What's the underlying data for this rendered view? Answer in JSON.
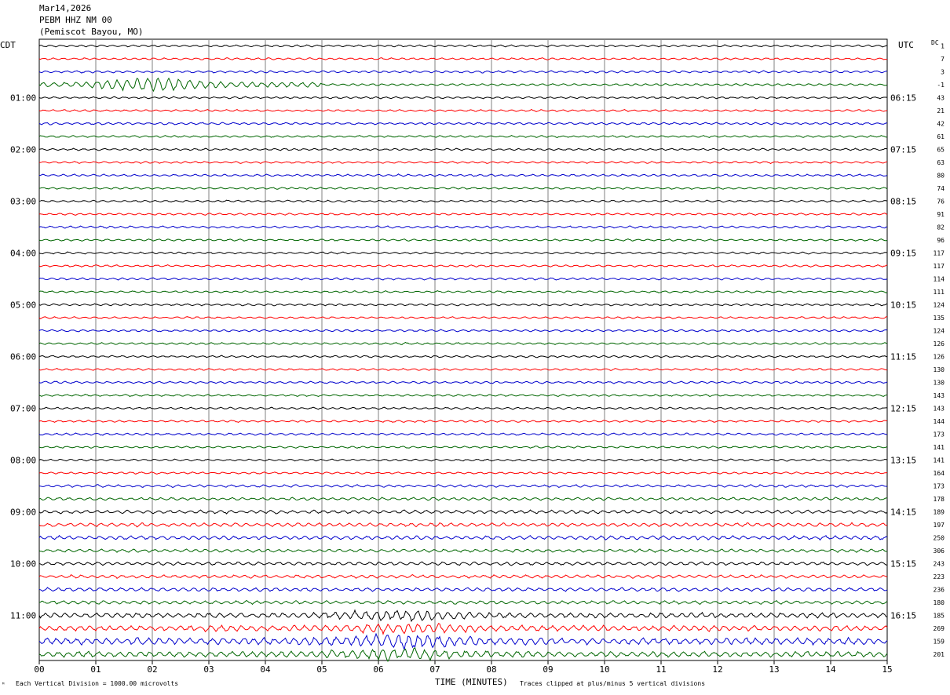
{
  "header": {
    "date": "Mar14,2026",
    "station": "PEBM HHZ NM 00",
    "location": "(Pemiscot Bayou, MO)"
  },
  "left_tz": "CDT",
  "right_tz": "UTC",
  "dc_label": "DC",
  "footer": {
    "scale_note": "Each Vertical Division = 1000.00 microvolts",
    "xlabel": "TIME (MINUTES)",
    "clip_note": "Traces clipped at plus/minus 5 vertical divisions"
  },
  "colors": {
    "trace_cycle": [
      "#000000",
      "#ff0000",
      "#0000cc",
      "#006600"
    ],
    "grid": "#808080"
  },
  "chart_data": {
    "type": "line",
    "title": "PEBM HHZ NM 00",
    "xlabel": "TIME (MINUTES)",
    "xlim": [
      0,
      15
    ],
    "x_ticks": [
      "00",
      "01",
      "02",
      "03",
      "04",
      "05",
      "06",
      "07",
      "08",
      "09",
      "10",
      "11",
      "12",
      "13",
      "14",
      "15"
    ],
    "left_hour_labels": [
      {
        "row": 4,
        "text": "01:00"
      },
      {
        "row": 8,
        "text": "02:00"
      },
      {
        "row": 12,
        "text": "03:00"
      },
      {
        "row": 16,
        "text": "04:00"
      },
      {
        "row": 20,
        "text": "05:00"
      },
      {
        "row": 24,
        "text": "06:00"
      },
      {
        "row": 28,
        "text": "07:00"
      },
      {
        "row": 32,
        "text": "08:00"
      },
      {
        "row": 36,
        "text": "09:00"
      },
      {
        "row": 40,
        "text": "10:00"
      },
      {
        "row": 44,
        "text": "11:00"
      }
    ],
    "right_hour_labels": [
      {
        "row": 4,
        "text": "06:15"
      },
      {
        "row": 8,
        "text": "07:15"
      },
      {
        "row": 12,
        "text": "08:15"
      },
      {
        "row": 16,
        "text": "09:15"
      },
      {
        "row": 20,
        "text": "10:15"
      },
      {
        "row": 24,
        "text": "11:15"
      },
      {
        "row": 28,
        "text": "12:15"
      },
      {
        "row": 32,
        "text": "13:15"
      },
      {
        "row": 36,
        "text": "14:15"
      },
      {
        "row": 40,
        "text": "15:15"
      },
      {
        "row": 44,
        "text": "16:15"
      }
    ],
    "dc_offsets": [
      "1",
      "7",
      "3",
      "-1",
      "43",
      "21",
      "42",
      "61",
      "65",
      "63",
      "80",
      "74",
      "76",
      "91",
      "82",
      "96",
      "117",
      "117",
      "114",
      "111",
      "124",
      "135",
      "124",
      "126",
      "126",
      "130",
      "130",
      "143",
      "143",
      "144",
      "173",
      "141",
      "141",
      "164",
      "173",
      "178",
      "189",
      "197",
      "250",
      "306",
      "243",
      "223",
      "236",
      "180",
      "185",
      "269",
      "159",
      "201"
    ],
    "trace_amplitude": [
      0.9,
      0.9,
      1.0,
      3.5,
      0.9,
      0.9,
      1.0,
      0.9,
      0.9,
      0.9,
      1.0,
      0.9,
      0.9,
      0.9,
      1.0,
      0.9,
      0.9,
      0.9,
      1.0,
      0.9,
      0.9,
      0.9,
      1.0,
      0.9,
      0.9,
      0.9,
      1.0,
      0.9,
      0.9,
      0.9,
      1.0,
      0.9,
      0.9,
      0.9,
      1.2,
      1.3,
      1.6,
      1.7,
      1.8,
      1.4,
      1.5,
      1.5,
      1.6,
      1.6,
      2.4,
      2.6,
      3.2,
      2.6
    ]
  }
}
